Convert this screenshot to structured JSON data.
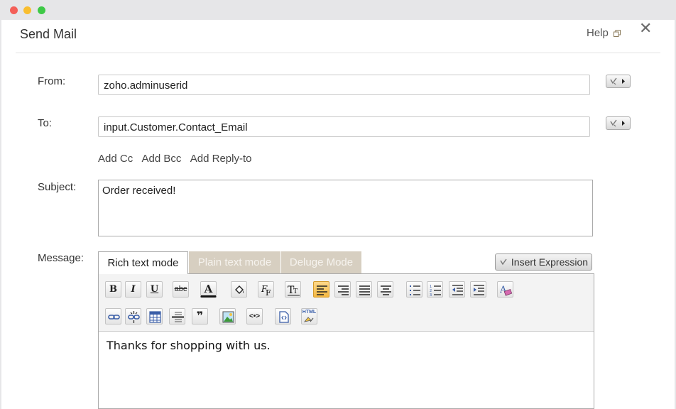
{
  "window": {
    "title": "Send Mail",
    "help_label": "Help",
    "close_glyph": "✕"
  },
  "form": {
    "from_label": "From:",
    "from_value": "zoho.adminuserid",
    "to_label": "To:",
    "to_value": "input.Customer.Contact_Email",
    "add_cc": "Add Cc",
    "add_bcc": "Add Bcc",
    "add_reply_to": "Add Reply-to",
    "subject_label": "Subject:",
    "subject_value": "Order received!",
    "message_label": "Message:"
  },
  "tabs": [
    {
      "label": "Rich text mode",
      "active": true
    },
    {
      "label": "Plain text mode",
      "active": false
    },
    {
      "label": "Deluge Mode",
      "active": false
    }
  ],
  "insert_expression_label": "Insert Expression",
  "toolbar": {
    "row1": [
      "bold-icon",
      "italic-icon",
      "underline-icon",
      "strikethrough-icon",
      "font-color-icon",
      "highlight-fill-icon",
      "font-family-icon",
      "font-size-icon",
      "align-left-icon",
      "align-right-icon",
      "align-justify-icon",
      "align-center-icon",
      "bulleted-list-icon",
      "numbered-list-icon",
      "outdent-icon",
      "indent-icon",
      "clear-format-icon"
    ],
    "row2": [
      "insert-link-icon",
      "remove-link-icon",
      "insert-table-icon",
      "horizontal-rule-icon",
      "blockquote-icon",
      "insert-image-icon",
      "source-code-icon",
      "insert-template-icon",
      "html-icon"
    ],
    "bold": "B",
    "italic": "I",
    "underline": "U",
    "strike": "abc",
    "font_color": "A",
    "quote": "❞",
    "code": "<•>",
    "html_label": "HTML"
  },
  "message_body": "Thanks for shopping with us.",
  "colors": {
    "tab_inactive_bg": "#d7cfc1",
    "active_align_bg": "#f4b841",
    "close_red": "#f45f58",
    "minimize_yellow": "#f9be2f",
    "zoom_green": "#3ec946"
  }
}
